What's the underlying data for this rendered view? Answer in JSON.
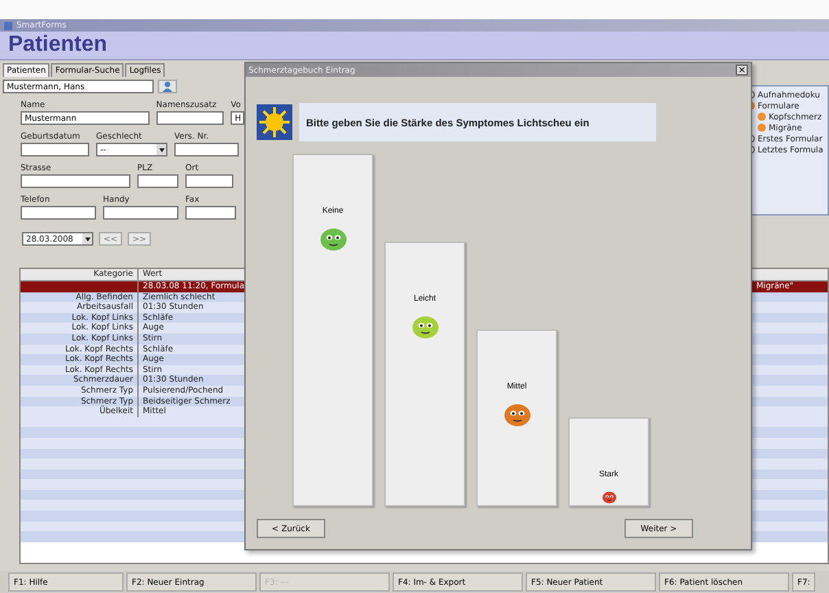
{
  "window": {
    "title": "SmartForms"
  },
  "header": {
    "title": "Patienten"
  },
  "tabs": [
    {
      "label": "Patienten",
      "selected": true
    },
    {
      "label": "Formular-Suche",
      "selected": false
    },
    {
      "label": "Logfiles",
      "selected": false
    }
  ],
  "patient_search": {
    "value": "Mustermann, Hans"
  },
  "form": {
    "fields": [
      {
        "label": "Name",
        "value": "Mustermann",
        "kind": "text"
      },
      {
        "label": "Namenszusatz",
        "kind": "text"
      },
      {
        "label": "Vo",
        "value": "H",
        "kind": "text"
      },
      {
        "label": "Geburtsdatum",
        "kind": "text"
      },
      {
        "label": "Geschlecht",
        "value": "--",
        "kind": "dropdown"
      },
      {
        "label": "Vers. Nr.",
        "kind": "text"
      },
      {
        "label": "Strasse",
        "kind": "text"
      },
      {
        "label": "PLZ",
        "kind": "text"
      },
      {
        "label": "Ort",
        "kind": "text"
      },
      {
        "label": "Telefon",
        "kind": "text"
      },
      {
        "label": "Handy",
        "kind": "text"
      },
      {
        "label": "Fax",
        "kind": "text"
      }
    ]
  },
  "date_nav": {
    "date": "28.03.2008",
    "prev": "<<",
    "next": ">>"
  },
  "tree": [
    {
      "label": "Aufnahmedoku",
      "kind": "document"
    },
    {
      "label": "Formulare",
      "kind": "folder",
      "children": [
        {
          "label": "Kopfschmerz",
          "kind": "folder"
        },
        {
          "label": "Migräne",
          "kind": "folder"
        }
      ]
    },
    {
      "label": "Erstes Formular",
      "kind": "document"
    },
    {
      "label": "Letztes Formula",
      "kind": "document"
    }
  ],
  "table": {
    "columns": [
      "Kategorie",
      "Wert"
    ],
    "rows": [
      {
        "kategorie": "",
        "wert": "28.03.08 11:20, Formula",
        "tail": "Migräne\"",
        "selected": true
      },
      {
        "kategorie": "Allg. Befinden",
        "wert": "Ziemlich schlecht",
        "selected": false
      },
      {
        "kategorie": "Arbeitsausfall",
        "wert": "01:30 Stunden",
        "selected": false
      },
      {
        "kategorie": "Lok. Kopf Links",
        "wert": "Schläfe",
        "selected": false
      },
      {
        "kategorie": "Lok. Kopf Links",
        "wert": "Auge",
        "selected": false
      },
      {
        "kategorie": "Lok. Kopf Links",
        "wert": "Stirn",
        "selected": false
      },
      {
        "kategorie": "Lok. Kopf Rechts",
        "wert": "Schläfe",
        "selected": false
      },
      {
        "kategorie": "Lok. Kopf Rechts",
        "wert": "Auge",
        "selected": false
      },
      {
        "kategorie": "Lok. Kopf Rechts",
        "wert": "Stirn",
        "selected": false
      },
      {
        "kategorie": "Schmerzdauer",
        "wert": "01:30 Stunden",
        "selected": false
      },
      {
        "kategorie": "Schmerz Typ",
        "wert": "Pulsierend/Pochend",
        "selected": false
      },
      {
        "kategorie": "Schmerz Typ",
        "wert": "Beidseitiger Schmerz",
        "selected": false
      },
      {
        "kategorie": "Übelkeit",
        "wert": "Mittel",
        "selected": false
      }
    ]
  },
  "function_keys": [
    {
      "label": "F1: Hilfe",
      "disabled": false
    },
    {
      "label": "F2: Neuer Eintrag",
      "disabled": false
    },
    {
      "label": "F3: ---",
      "disabled": true
    },
    {
      "label": "F4: Im- & Export",
      "disabled": false
    },
    {
      "label": "F5: Neuer Patient",
      "disabled": false
    },
    {
      "label": "F6: Patient löschen",
      "disabled": false
    },
    {
      "label": "F7:",
      "disabled": false
    }
  ],
  "dialog": {
    "title": "Schmerztagebuch Eintrag",
    "close": "×",
    "prompt": "Bitte geben Sie die Stärke des Symptomes Lichtscheu ein",
    "options": [
      {
        "label": "Keine",
        "color": "#6cc04a"
      },
      {
        "label": "Leicht",
        "color": "#a6d03a"
      },
      {
        "label": "Mittel",
        "color": "#e07a20"
      },
      {
        "label": "Stark",
        "color": "#d8402a"
      }
    ],
    "back": "< Zurück",
    "next": "Weiter >"
  }
}
